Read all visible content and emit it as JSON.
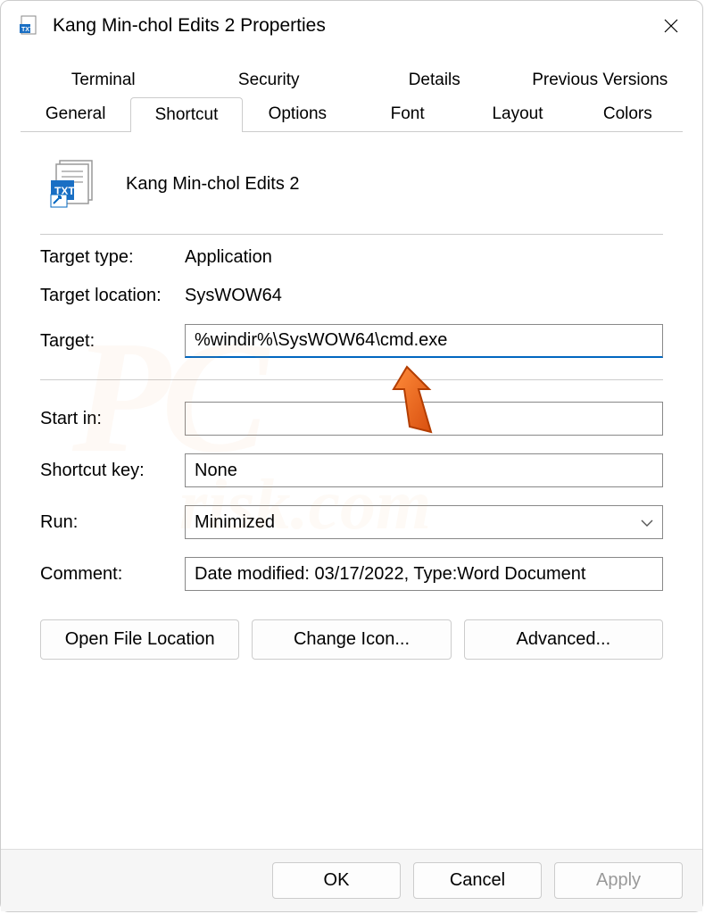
{
  "window": {
    "title": "Kang Min-chol Edits 2 Properties"
  },
  "tabs": {
    "row1": [
      "Terminal",
      "Security",
      "Details",
      "Previous Versions"
    ],
    "row2": [
      "General",
      "Shortcut",
      "Options",
      "Font",
      "Layout",
      "Colors"
    ],
    "active": "Shortcut"
  },
  "shortcut": {
    "name": "Kang Min-chol Edits 2",
    "target_type_label": "Target type:",
    "target_type_value": "Application",
    "target_location_label": "Target location:",
    "target_location_value": "SysWOW64",
    "target_label": "Target:",
    "target_value": "%windir%\\SysWOW64\\cmd.exe",
    "startin_label": "Start in:",
    "startin_value": "",
    "shortcutkey_label": "Shortcut key:",
    "shortcutkey_value": "None",
    "run_label": "Run:",
    "run_value": "Minimized",
    "comment_label": "Comment:",
    "comment_value": "Date modified: 03/17/2022, Type:Word Document"
  },
  "buttons": {
    "open_file_location": "Open File Location",
    "change_icon": "Change Icon...",
    "advanced": "Advanced...",
    "ok": "OK",
    "cancel": "Cancel",
    "apply": "Apply"
  },
  "watermark": {
    "text1": "PC",
    "text2": "risk.com"
  }
}
